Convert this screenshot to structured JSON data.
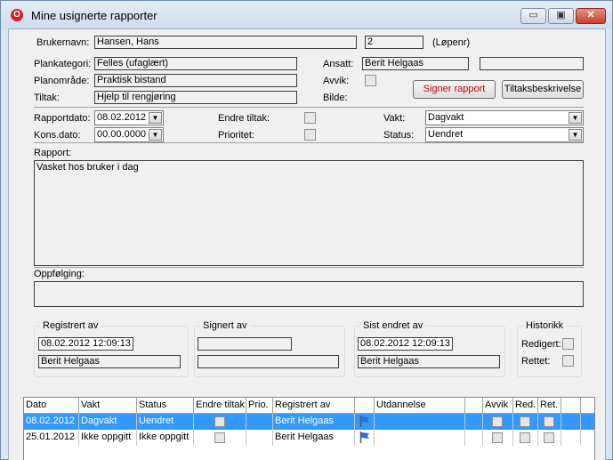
{
  "window": {
    "title": "Mine usignerte rapporter",
    "app_icon": "opera-o-icon",
    "controls": {
      "minimize": "▭",
      "maximize": "▣",
      "close": "✕"
    }
  },
  "header": {
    "brukernavn_label": "Brukernavn:",
    "brukernavn_value": "Hansen, Hans",
    "lopenr_value": "2",
    "lopenr_label": "(Løpenr)",
    "plankategori_label": "Plankategori:",
    "plankategori_value": "Felles (ufaglært)",
    "planomrade_label": "Planområde:",
    "planomrade_value": "Praktisk bistand",
    "tiltak_label": "Tiltak:",
    "tiltak_value": "Hjelp til rengjøring",
    "ansatt_label": "Ansatt:",
    "ansatt_value": "Berit Helgaas",
    "ansatt_extra_value": "",
    "avvik_label": "Avvik:",
    "bilde_label": "Bilde:",
    "signer_button": "Signer rapport",
    "tiltaksbeskrivelse_button": "Tiltaksbeskrivelse"
  },
  "details": {
    "rapportdato_label": "Rapportdato:",
    "rapportdato_value": "08.02.2012",
    "konsdato_label": "Kons.dato:",
    "konsdato_value": "00.00.0000",
    "endre_tiltak_label": "Endre tiltak:",
    "prioritet_label": "Prioritet:",
    "vakt_label": "Vakt:",
    "vakt_value": "Dagvakt",
    "status_label": "Status:",
    "status_value": "Uendret"
  },
  "rapport": {
    "label": "Rapport:",
    "text": "Vasket hos bruker i dag"
  },
  "oppfolging": {
    "label": "Oppfølging:",
    "text": ""
  },
  "registrert": {
    "title": "Registrert av",
    "datetime": "08.02.2012  12:09:13",
    "name": "Berit Helgaas"
  },
  "signert": {
    "title": "Signert av",
    "datetime": "",
    "name": ""
  },
  "sist_endret": {
    "title": "Sist endret av",
    "datetime": "08.02.2012  12:09:13",
    "name": "Berit Helgaas"
  },
  "historikk": {
    "title": "Historikk",
    "redigert_label": "Redigert:",
    "rettet_label": "Rettet:"
  },
  "table": {
    "columns": [
      "Dato",
      "Vakt",
      "Status",
      "Endre tiltak",
      "Prio.",
      "Registrert av",
      "",
      "Utdannelse",
      "",
      "Avvik",
      "Red.",
      "Ret.",
      ""
    ],
    "rows": [
      {
        "dato": "08.02.2012",
        "vakt": "Dagvakt",
        "status": "Uendret",
        "registrert_av": "Berit Helgaas",
        "utdannelse": "",
        "selected": true
      },
      {
        "dato": "25.01.2012",
        "vakt": "Ikke oppgitt",
        "status": "Ikke oppgitt",
        "registrert_av": "Berit Helgaas",
        "utdannelse": "",
        "selected": false
      }
    ]
  },
  "colors": {
    "selection": "#3399ff",
    "signer_text": "#cc0000",
    "flag": "#2a6fd6"
  }
}
